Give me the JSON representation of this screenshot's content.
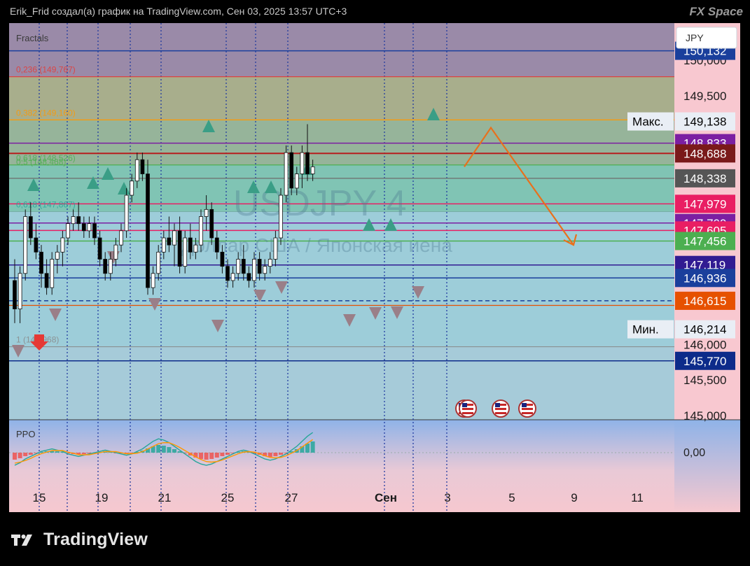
{
  "header": {
    "attribution": "Erik_Frid создал(а) график на TradingView.com, Сен 03, 2025 13:57 UTC+3",
    "watermark_brand": "FX Space"
  },
  "footer": {
    "logo_text": "TradingView"
  },
  "chart": {
    "symbol_watermark": "USDJPY 4",
    "symbol_desc_watermark": "Доллар США / Японская иена",
    "currency_label": "JPY",
    "indicator_main": "Fractals",
    "indicator_sub": "PPO",
    "max_label": "Макс.",
    "min_label": "Мин.",
    "colors": {
      "up": "#ffffff",
      "down": "#000000",
      "arrow": "#e8701c",
      "ppo_line": "#26a69a",
      "ppo_signal": "#ff9800"
    }
  },
  "chart_data": {
    "type": "candlestick",
    "title": "USDJPY 4",
    "price_scale": {
      "ticks": [
        "150,000",
        "149,500",
        "146,000",
        "145,500",
        "145,000"
      ],
      "ylim": [
        145.0,
        150.2
      ]
    },
    "x_axis_ticks": [
      "15",
      "19",
      "21",
      "25",
      "27",
      "Сен",
      "3",
      "5",
      "9",
      "11"
    ],
    "price_badges": [
      {
        "label": "150,132",
        "value": 150.132,
        "color": "#1a3f9c"
      },
      {
        "label": "149,138",
        "value": 149.138,
        "color": "#e9eef5",
        "text_color": "#000000",
        "note": "Макс."
      },
      {
        "label": "148,833",
        "value": 148.833,
        "color": "#7b1fa2"
      },
      {
        "label": "148,688",
        "value": 148.688,
        "color": "#7a1a1a"
      },
      {
        "label": "148,338",
        "value": 148.338,
        "color": "#555555"
      },
      {
        "label": "147,979",
        "value": 147.979,
        "color": "#e91e63"
      },
      {
        "label": "147,709",
        "value": 147.709,
        "color": "#7b1fa2"
      },
      {
        "label": "147,605",
        "value": 147.605,
        "color": "#e91e63"
      },
      {
        "label": "147,456",
        "value": 147.456,
        "color": "#4caf50"
      },
      {
        "label": "147.119",
        "value": 147.119,
        "color": "#311b92"
      },
      {
        "label": "146,936",
        "value": 146.936,
        "color": "#1a3f9c"
      },
      {
        "label": "146,615",
        "value": 146.615,
        "color": "#e65100"
      },
      {
        "label": "146,214",
        "value": 146.214,
        "color": "#e9eef5",
        "text_color": "#000000",
        "note": "Мин."
      },
      {
        "label": "145,770",
        "value": 145.77,
        "color": "#0d2b8a"
      }
    ],
    "fib_levels": [
      {
        "label": "0,236 (149,767)",
        "ratio": 0.236,
        "price": 149.767,
        "color": "#e53935"
      },
      {
        "label": "0,382 (149,160)",
        "ratio": 0.382,
        "price": 149.16,
        "color": "#ff9800"
      },
      {
        "label": "0,618 (148,526)",
        "ratio": 0.618,
        "price": 148.526,
        "color": "#4caf50"
      },
      {
        "label": "0,5 (148,468)",
        "ratio": 0.5,
        "price": 148.468,
        "color": "#4caf50"
      },
      {
        "label": "0,618 (147,867)",
        "ratio": 0.618,
        "price": 147.867,
        "color": "#26a69a"
      },
      {
        "label": "1 (145,968)",
        "ratio": 1,
        "price": 145.968,
        "color": "#888888"
      }
    ],
    "ppo": {
      "zero_label": "0,00"
    },
    "candles": [
      [
        146.9,
        147.2,
        146.3,
        146.5
      ],
      [
        146.5,
        147.1,
        146.3,
        147.0
      ],
      [
        147.0,
        147.9,
        146.9,
        147.8
      ],
      [
        147.8,
        148.0,
        147.4,
        147.5
      ],
      [
        147.5,
        147.7,
        147.2,
        147.3
      ],
      [
        147.3,
        147.4,
        146.8,
        147.0
      ],
      [
        147.0,
        147.2,
        146.7,
        146.8
      ],
      [
        146.8,
        147.3,
        146.7,
        147.2
      ],
      [
        147.2,
        147.4,
        147.0,
        147.3
      ],
      [
        147.3,
        147.6,
        147.1,
        147.5
      ],
      [
        147.5,
        147.8,
        147.4,
        147.7
      ],
      [
        147.7,
        147.9,
        147.6,
        147.8
      ],
      [
        147.8,
        148.0,
        147.6,
        147.7
      ],
      [
        147.7,
        147.8,
        147.5,
        147.6
      ],
      [
        147.6,
        147.8,
        147.5,
        147.7
      ],
      [
        147.7,
        147.8,
        147.4,
        147.5
      ],
      [
        147.5,
        147.6,
        147.1,
        147.2
      ],
      [
        147.2,
        147.3,
        146.9,
        147.0
      ],
      [
        147.0,
        147.3,
        146.9,
        147.2
      ],
      [
        147.2,
        147.5,
        147.1,
        147.4
      ],
      [
        147.4,
        147.7,
        147.3,
        147.6
      ],
      [
        147.6,
        148.2,
        147.5,
        148.1
      ],
      [
        148.1,
        148.4,
        148.0,
        148.3
      ],
      [
        148.3,
        148.7,
        148.2,
        148.6
      ],
      [
        148.6,
        148.7,
        148.3,
        148.4
      ],
      [
        148.4,
        148.6,
        146.7,
        146.8
      ],
      [
        146.8,
        147.1,
        146.7,
        147.0
      ],
      [
        147.0,
        147.4,
        146.9,
        147.3
      ],
      [
        147.3,
        147.6,
        147.2,
        147.5
      ],
      [
        147.5,
        147.8,
        147.3,
        147.4
      ],
      [
        147.4,
        147.7,
        147.1,
        147.6
      ],
      [
        147.6,
        147.8,
        147.0,
        147.1
      ],
      [
        147.1,
        147.6,
        147.0,
        147.5
      ],
      [
        147.5,
        147.7,
        147.2,
        147.3
      ],
      [
        147.3,
        147.5,
        147.2,
        147.4
      ],
      [
        147.4,
        147.9,
        147.3,
        147.8
      ],
      [
        147.8,
        148.1,
        147.6,
        147.9
      ],
      [
        147.9,
        148.0,
        147.4,
        147.5
      ],
      [
        147.5,
        147.6,
        147.2,
        147.3
      ],
      [
        147.3,
        147.4,
        147.0,
        147.1
      ],
      [
        147.1,
        147.2,
        146.8,
        146.9
      ],
      [
        146.9,
        147.1,
        146.8,
        147.0
      ],
      [
        147.0,
        147.3,
        146.9,
        147.2
      ],
      [
        147.2,
        147.4,
        146.9,
        147.0
      ],
      [
        147.0,
        147.1,
        146.8,
        146.9
      ],
      [
        146.9,
        147.3,
        146.8,
        147.2
      ],
      [
        147.2,
        147.3,
        146.9,
        147.0
      ],
      [
        147.0,
        147.2,
        146.9,
        147.1
      ],
      [
        147.1,
        147.3,
        147.0,
        147.2
      ],
      [
        147.2,
        147.6,
        147.1,
        147.5
      ],
      [
        147.5,
        148.2,
        147.4,
        148.1
      ],
      [
        148.1,
        148.8,
        148.0,
        148.7
      ],
      [
        148.7,
        148.8,
        148.1,
        148.2
      ],
      [
        148.2,
        148.5,
        148.1,
        148.4
      ],
      [
        148.4,
        148.8,
        148.2,
        148.7
      ],
      [
        148.7,
        149.1,
        148.3,
        148.4
      ],
      [
        148.4,
        148.6,
        148.3,
        148.5
      ]
    ],
    "projection": [
      [
        148.5,
        149.1
      ],
      [
        147.45
      ]
    ]
  }
}
